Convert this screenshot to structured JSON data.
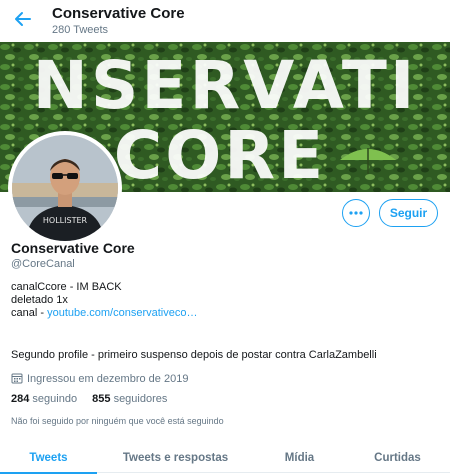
{
  "header": {
    "title": "Conservative Core",
    "tweet_count": "280 Tweets"
  },
  "banner": {
    "line1": "NSERVATI",
    "line2": "CORE",
    "background_color": "#2f5a22",
    "text_color": "#ffffff"
  },
  "profile": {
    "name": "Conservative Core",
    "handle": "@CoreCanal",
    "bio_line1": "canalCcore - IM BACK",
    "bio_line2": "deletado 1x",
    "bio_line3_prefix": "canal - ",
    "bio_link": "youtube.com/conservativeco…",
    "bio_line4": "Segundo profile - primeiro suspenso depois de postar contra CarlaZambelli",
    "joined": "Ingressou em dezembro de 2019",
    "following_count": "284",
    "following_label": "seguindo",
    "followers_count": "855",
    "followers_label": "seguidores",
    "mutual_note": "Não foi seguido por ninguém que você está seguindo",
    "shirt_text": "HOLLISTER"
  },
  "actions": {
    "follow_label": "Seguir",
    "more_icon": "more-horizontal-icon"
  },
  "tabs": [
    {
      "label": "Tweets",
      "active": true
    },
    {
      "label": "Tweets e respostas",
      "active": false
    },
    {
      "label": "Mídia",
      "active": false
    },
    {
      "label": "Curtidas",
      "active": false
    }
  ],
  "colors": {
    "accent": "#1da1f2",
    "text": "#14171a",
    "muted": "#657786"
  }
}
